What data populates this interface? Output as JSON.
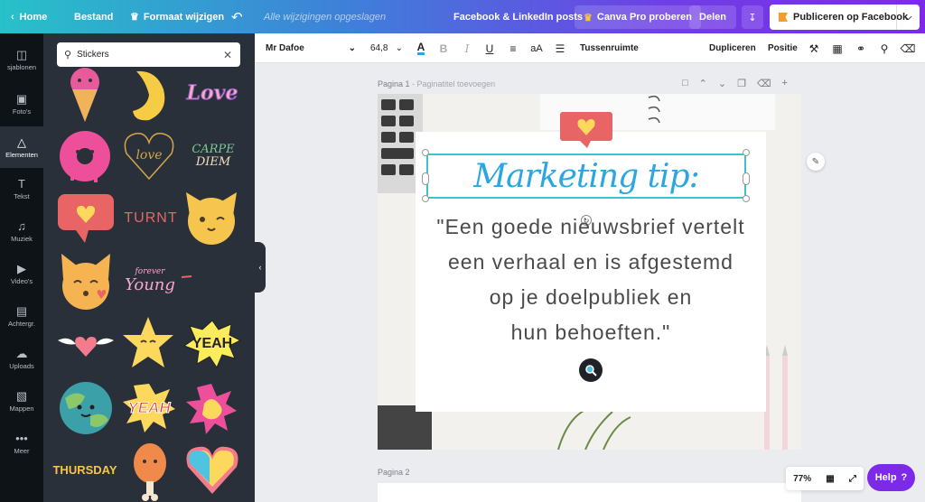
{
  "topbar": {
    "home": "Home",
    "file": "Bestand",
    "resize": "Formaat wijzigen",
    "saved_status": "Alle wijzigingen opgeslagen",
    "doc_title": "Facebook & LinkedIn posts",
    "pro": "Canva Pro proberen",
    "share": "Delen",
    "publish": "Publiceren op Facebook"
  },
  "rail": [
    {
      "label": "sjablonen",
      "icon": "templates-icon"
    },
    {
      "label": "Foto's",
      "icon": "photos-icon"
    },
    {
      "label": "Elementen",
      "icon": "elements-icon"
    },
    {
      "label": "Tekst",
      "icon": "text-icon"
    },
    {
      "label": "Muziek",
      "icon": "music-icon"
    },
    {
      "label": "Video's",
      "icon": "video-icon"
    },
    {
      "label": "Achtergr.",
      "icon": "background-icon"
    },
    {
      "label": "Uploads",
      "icon": "uploads-icon"
    },
    {
      "label": "Mappen",
      "icon": "folders-icon"
    },
    {
      "label": "Meer",
      "icon": "more-icon"
    }
  ],
  "panel": {
    "search_value": "Stickers",
    "stickers": {
      "love": "Love",
      "love_heart": "love",
      "carpe_1": "CARPE",
      "carpe_2": "DIEM",
      "turnt": "TURNT",
      "forever_1": "forever",
      "forever_2": "Young",
      "yeah": "YEAH",
      "yeah2": "YEAH",
      "thursday": "THURSDAY"
    }
  },
  "toolbar": {
    "font": "Mr Dafoe",
    "size": "64,8",
    "spacing": "Tussenruimte",
    "duplicate": "Dupliceren",
    "position": "Positie"
  },
  "canvas": {
    "page1_label": "Pagina 1",
    "page1_sep": " - ",
    "page1_title_placeholder": "Paginatitel toevoegen",
    "page2_label": "Pagina 2",
    "heading": "Marketing tip:",
    "quote_lines": [
      "\"Een goede nieuwsbrief vertelt",
      "een verhaal en is afgestemd",
      "op je doelpubliek en",
      "hun behoeften.\""
    ],
    "zoom": "77%",
    "help": "Help"
  },
  "colors": {
    "accent": "#7d2ae8",
    "teal": "#3bc2cb",
    "heading_blue": "#2aa6e0",
    "sticker_coral": "#e96465",
    "sticker_yellow": "#fcd85c"
  }
}
